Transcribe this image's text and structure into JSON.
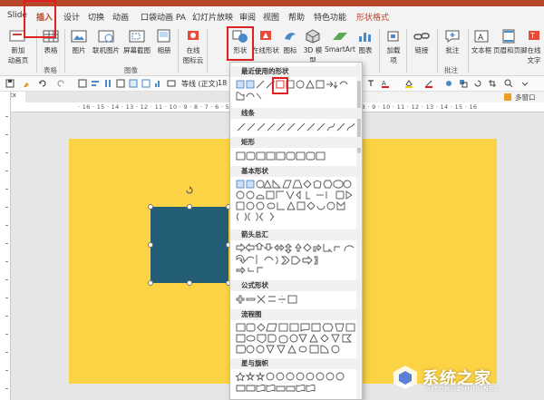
{
  "colors": {
    "accent": "#b7472a",
    "slide_bg": "#fbd345",
    "shape_fill": "#235d76",
    "highlight": "#e02020"
  },
  "tabs": [
    {
      "label": "Slide"
    },
    {
      "label": "插入"
    },
    {
      "label": "设计"
    },
    {
      "label": "切换"
    },
    {
      "label": "动画"
    },
    {
      "label": "口袋动画 PA"
    },
    {
      "label": "幻灯片放映"
    },
    {
      "label": "审阅"
    },
    {
      "label": "视图"
    },
    {
      "label": "帮助"
    },
    {
      "label": "特色功能"
    },
    {
      "label": "形状格式"
    }
  ],
  "ribbon": {
    "new_slide": "新加\n动画页",
    "table": "表格",
    "picture": "图片",
    "online_picture": "联机图片",
    "screenshot": "屏幕截图",
    "album": "相册",
    "online_icons": "在线\n图标云",
    "shapes": "形状",
    "online_shapes": "在线形状",
    "icons": "图标",
    "model3d": "3D 模\n型",
    "smartart": "SmartArt",
    "chart": "图表",
    "addins": "加载\n项",
    "link": "链接",
    "comment": "批注",
    "textbox": "文本框",
    "header_footer": "页眉和页脚",
    "wordart": "在线\n文字",
    "group_table": "表格",
    "group_image": "图像",
    "group_comment": "批注"
  },
  "quickbar": {
    "font": "等线 (正文)",
    "size": "18",
    "pane_label": "多窗口",
    "file_tab": "pptx"
  },
  "ruler": {
    "h_ticks": "· 16 · 15 · 14 · 13 · 12 · 11 · 10 · 9 · 8 · 7 · 6 · 5 · 4 · 3 · 2 · 1 · 0 · 1 · 2 · 3 · 4 · 5 · 6 · 7 · 8 · 9 · 10 · 11 · 12 · 13 · 14 · 15 · 16"
  },
  "shapes_menu": {
    "sections": [
      "最近使用的形状",
      "线条",
      "矩形",
      "基本形状",
      "箭头总汇",
      "公式形状",
      "流程图",
      "星与旗帜"
    ]
  },
  "watermark": {
    "text": "系统之家",
    "sub": "XITONGZHIJIA.NET"
  }
}
